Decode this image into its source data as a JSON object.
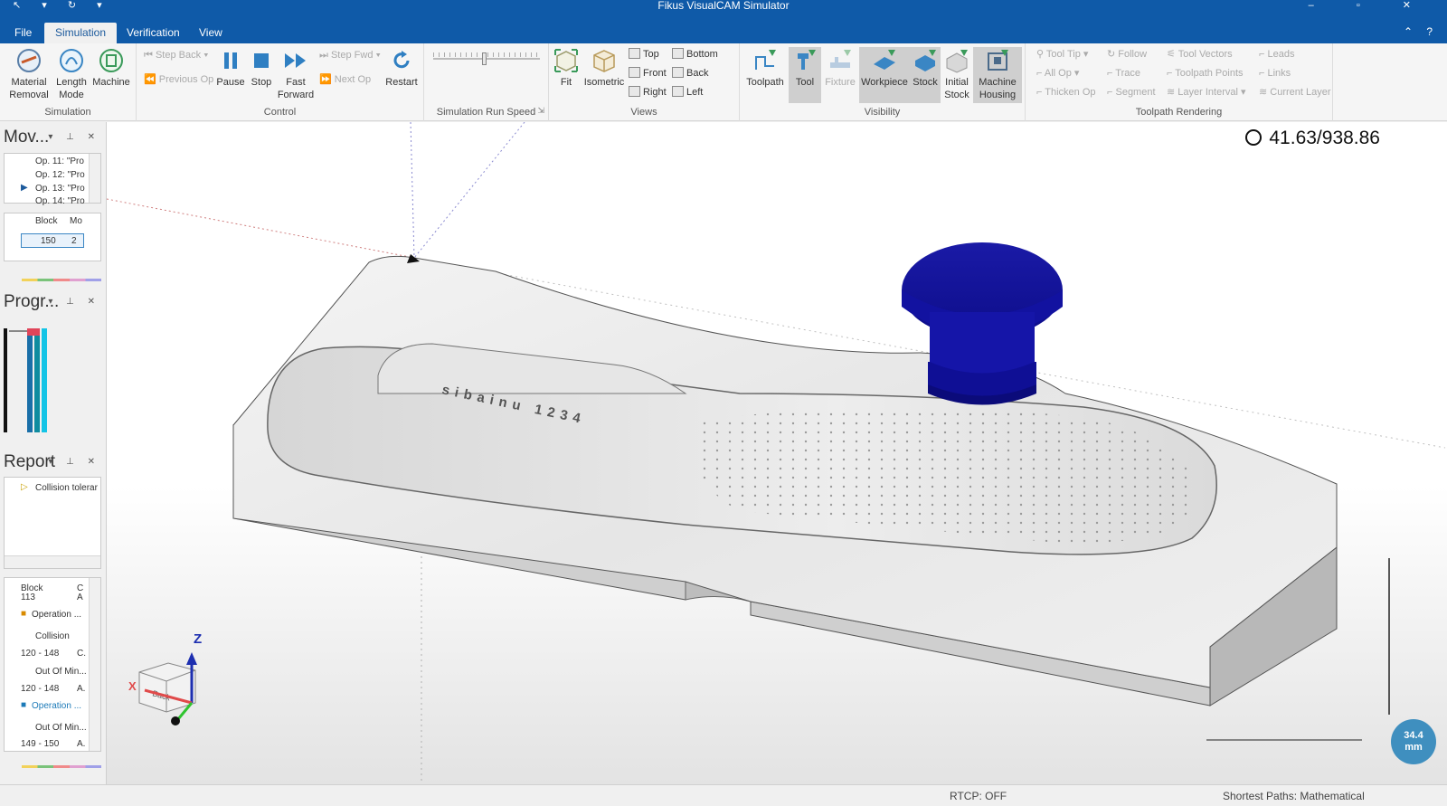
{
  "window": {
    "title": "Fikus VisualCAM Simulator"
  },
  "tabs": [
    "File",
    "Simulation",
    "Verification",
    "View"
  ],
  "ribbon": {
    "simulation": {
      "label": "Simulation",
      "material_removal": "Material Removal",
      "length_mode": "Length Mode",
      "machine": "Machine"
    },
    "control": {
      "label": "Control",
      "step_back": "Step Back",
      "previous_op": "Previous Op",
      "pause": "Pause",
      "stop": "Stop",
      "fast_forward": "Fast Forward",
      "step_fwd": "Step Fwd",
      "next_op": "Next Op",
      "restart": "Restart"
    },
    "speed": {
      "label": "Simulation Run Speed"
    },
    "views": {
      "label": "Views",
      "fit": "Fit",
      "isometric": "Isometric",
      "top": "Top",
      "front": "Front",
      "right": "Right",
      "bottom": "Bottom",
      "back": "Back",
      "left": "Left"
    },
    "visibility": {
      "label": "Visibility",
      "toolpath": "Toolpath",
      "tool": "Tool",
      "fixture": "Fixture",
      "workpiece": "Workpiece",
      "stock": "Stock",
      "initial_stock": "Initial Stock",
      "machine_housing": "Machine Housing"
    },
    "rendering": {
      "label": "Toolpath Rendering",
      "tool_tip": "Tool Tip",
      "follow": "Follow",
      "tool_vectors": "Tool Vectors",
      "leads": "Leads",
      "all_op": "All Op",
      "trace": "Trace",
      "toolpath_points": "Toolpath Points",
      "links": "Links",
      "thicken_op": "Thicken Op",
      "segment": "Segment",
      "layer_interval": "Layer Interval",
      "current_layer": "Current Layer"
    }
  },
  "panels": {
    "moves": {
      "title": "Mov...",
      "ops": [
        "Op. 11: \"Pro",
        "Op. 12: \"Pro",
        "Op. 13: \"Pro",
        "Op. 14: \"Pro"
      ],
      "col_block": "Block",
      "col_mo": "Mo",
      "row_block": "150",
      "row_mo": "2"
    },
    "progress": {
      "title": "Progr..."
    },
    "report": {
      "title": "Report",
      "item": "Collision tolerar"
    },
    "results": {
      "col_block": "Block",
      "col_c": "C",
      "rows": [
        {
          "label": "113",
          "value": "A"
        },
        {
          "label": "Operation ...",
          "value": ""
        },
        {
          "label": "Collision",
          "value": ""
        },
        {
          "label": "120 - 148",
          "value": "C."
        },
        {
          "label": "Out Of Min...",
          "value": ""
        },
        {
          "label": "120 - 148",
          "value": "A."
        },
        {
          "label": "Operation ...",
          "value": ""
        },
        {
          "label": "Out Of Min...",
          "value": ""
        },
        {
          "label": "149 - 150",
          "value": "A."
        }
      ]
    }
  },
  "viewport": {
    "counter": "41.63/938.86",
    "scale": {
      "value": "34.4",
      "unit": "mm"
    },
    "axis_z": "Z",
    "axis_x": "X",
    "cube_face": "Back",
    "engraving": "sibainu 1234"
  },
  "status": {
    "rtcp": "RTCP: OFF",
    "paths": "Shortest Paths: Mathematical"
  },
  "colors": {
    "titlebar": "#0f5aa8",
    "tool": "#1a1aa6",
    "accent": "#1c5a9c"
  }
}
